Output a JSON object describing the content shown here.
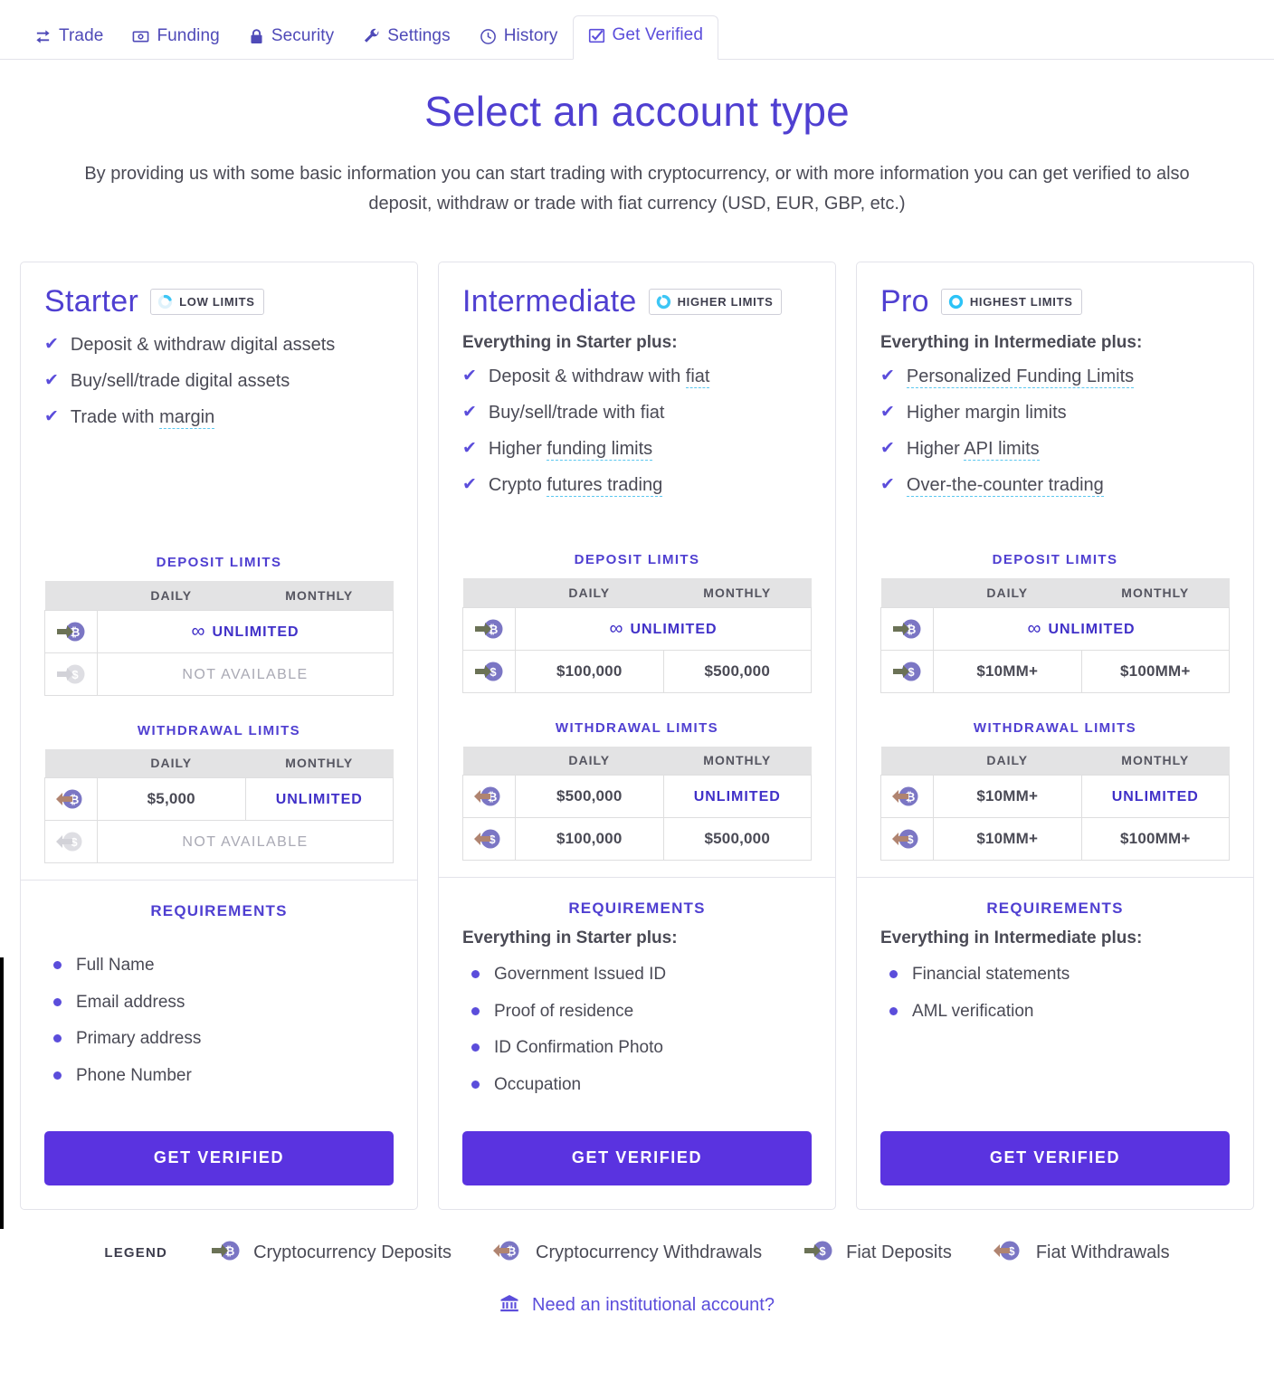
{
  "tabs": [
    {
      "label": "Trade",
      "icon": "exchange-icon",
      "active": false
    },
    {
      "label": "Funding",
      "icon": "banknote-icon",
      "active": false
    },
    {
      "label": "Security",
      "icon": "lock-icon",
      "active": false
    },
    {
      "label": "Settings",
      "icon": "wrench-icon",
      "active": false
    },
    {
      "label": "History",
      "icon": "clock-icon",
      "active": false
    },
    {
      "label": "Get Verified",
      "icon": "checkbox-checked-icon",
      "active": true
    }
  ],
  "header": {
    "title": "Select an account type",
    "subtitle": "By providing us with some basic information you can start trading with cryptocurrency, or with more information you can get verified to also deposit, withdraw or trade with fiat currency (USD, EUR, GBP, etc.)"
  },
  "colors": {
    "brand_purple": "#4f3fd1",
    "button_purple": "#5a33e0",
    "accent_cyan": "#5bc8f0",
    "coin_purple": "#7b76c4",
    "deposit_arrow": "#6b7256",
    "withdraw_arrow": "#b08470",
    "disabled_gray": "#d8d8dd",
    "table_header_bg": "#e3e3e4"
  },
  "labels": {
    "deposit_limits": "DEPOSIT LIMITS",
    "withdrawal_limits": "WITHDRAWAL LIMITS",
    "requirements": "REQUIREMENTS",
    "daily": "DAILY",
    "monthly": "MONTHLY",
    "unlimited": "UNLIMITED",
    "not_available": "NOT AVAILABLE",
    "infinity": "∞",
    "get_verified": "GET VERIFIED"
  },
  "cards": [
    {
      "name": "Starter",
      "badge": {
        "text": "LOW LIMITS",
        "icon": "ring-low-icon",
        "fill": 0.25
      },
      "plus_line": null,
      "features": [
        {
          "text": "Deposit & withdraw digital assets",
          "link": null
        },
        {
          "text": "Buy/sell/trade digital assets",
          "link": null
        },
        {
          "text": "Trade with ",
          "link": "margin"
        }
      ],
      "deposit": {
        "rows": [
          {
            "icon": "crypto-deposit-icon",
            "span": true,
            "value": "UNLIMITED",
            "style": "unlimited"
          },
          {
            "icon": "fiat-deposit-disabled-icon",
            "span": true,
            "value": "NOT AVAILABLE",
            "style": "na"
          }
        ]
      },
      "withdrawal": {
        "rows": [
          {
            "icon": "crypto-withdraw-icon",
            "span": false,
            "daily": "$5,000",
            "monthly": "UNLIMITED",
            "monthly_style": "unlimited"
          },
          {
            "icon": "fiat-withdraw-disabled-icon",
            "span": true,
            "value": "NOT AVAILABLE",
            "style": "na"
          }
        ]
      },
      "requirements": {
        "plus_line": null,
        "items": [
          "Full Name",
          "Email address",
          "Primary address",
          "Phone Number"
        ]
      }
    },
    {
      "name": "Intermediate",
      "badge": {
        "text": "HIGHER LIMITS",
        "icon": "ring-higher-icon",
        "fill": 0.6
      },
      "plus_line": "Everything in Starter plus:",
      "features": [
        {
          "text": "Deposit & withdraw with ",
          "link": "fiat"
        },
        {
          "text": "Buy/sell/trade with fiat",
          "link": null
        },
        {
          "text": "Higher ",
          "link": "funding limits"
        },
        {
          "text": "Crypto ",
          "link": "futures trading"
        }
      ],
      "deposit": {
        "rows": [
          {
            "icon": "crypto-deposit-icon",
            "span": true,
            "value": "UNLIMITED",
            "style": "unlimited"
          },
          {
            "icon": "fiat-deposit-icon",
            "span": false,
            "daily": "$100,000",
            "monthly": "$500,000"
          }
        ]
      },
      "withdrawal": {
        "rows": [
          {
            "icon": "crypto-withdraw-icon",
            "span": false,
            "daily": "$500,000",
            "monthly": "UNLIMITED",
            "monthly_style": "unlimited"
          },
          {
            "icon": "fiat-withdraw-icon",
            "span": false,
            "daily": "$100,000",
            "monthly": "$500,000"
          }
        ]
      },
      "requirements": {
        "plus_line": "Everything in Starter plus:",
        "items": [
          "Government Issued ID",
          "Proof of residence",
          "ID Confirmation Photo",
          "Occupation"
        ]
      }
    },
    {
      "name": "Pro",
      "badge": {
        "text": "HIGHEST LIMITS",
        "icon": "ring-highest-icon",
        "fill": 1.0
      },
      "plus_line": "Everything in Intermediate plus:",
      "features": [
        {
          "text": "",
          "link": "Personalized Funding Limits"
        },
        {
          "text": "Higher margin limits",
          "link": null
        },
        {
          "text": "Higher ",
          "link": "API limits"
        },
        {
          "text": "",
          "link": "Over-the-counter trading"
        }
      ],
      "deposit": {
        "rows": [
          {
            "icon": "crypto-deposit-icon",
            "span": true,
            "value": "UNLIMITED",
            "style": "unlimited"
          },
          {
            "icon": "fiat-deposit-icon",
            "span": false,
            "daily": "$10MM+",
            "monthly": "$100MM+"
          }
        ]
      },
      "withdrawal": {
        "rows": [
          {
            "icon": "crypto-withdraw-icon",
            "span": false,
            "daily": "$10MM+",
            "monthly": "UNLIMITED",
            "monthly_style": "unlimited"
          },
          {
            "icon": "fiat-withdraw-icon",
            "span": false,
            "daily": "$10MM+",
            "monthly": "$100MM+"
          }
        ]
      },
      "requirements": {
        "plus_line": "Everything in Intermediate plus:",
        "items": [
          "Financial statements",
          "AML verification"
        ]
      }
    }
  ],
  "legend": {
    "label": "LEGEND",
    "items": [
      {
        "text": "Cryptocurrency Deposits",
        "icon": "crypto-deposit-icon"
      },
      {
        "text": "Cryptocurrency Withdrawals",
        "icon": "crypto-withdraw-icon"
      },
      {
        "text": "Fiat Deposits",
        "icon": "fiat-deposit-icon"
      },
      {
        "text": "Fiat Withdrawals",
        "icon": "fiat-withdraw-icon"
      }
    ]
  },
  "footer": {
    "institutional_link": "Need an institutional account?",
    "institutional_icon": "bank-icon"
  }
}
